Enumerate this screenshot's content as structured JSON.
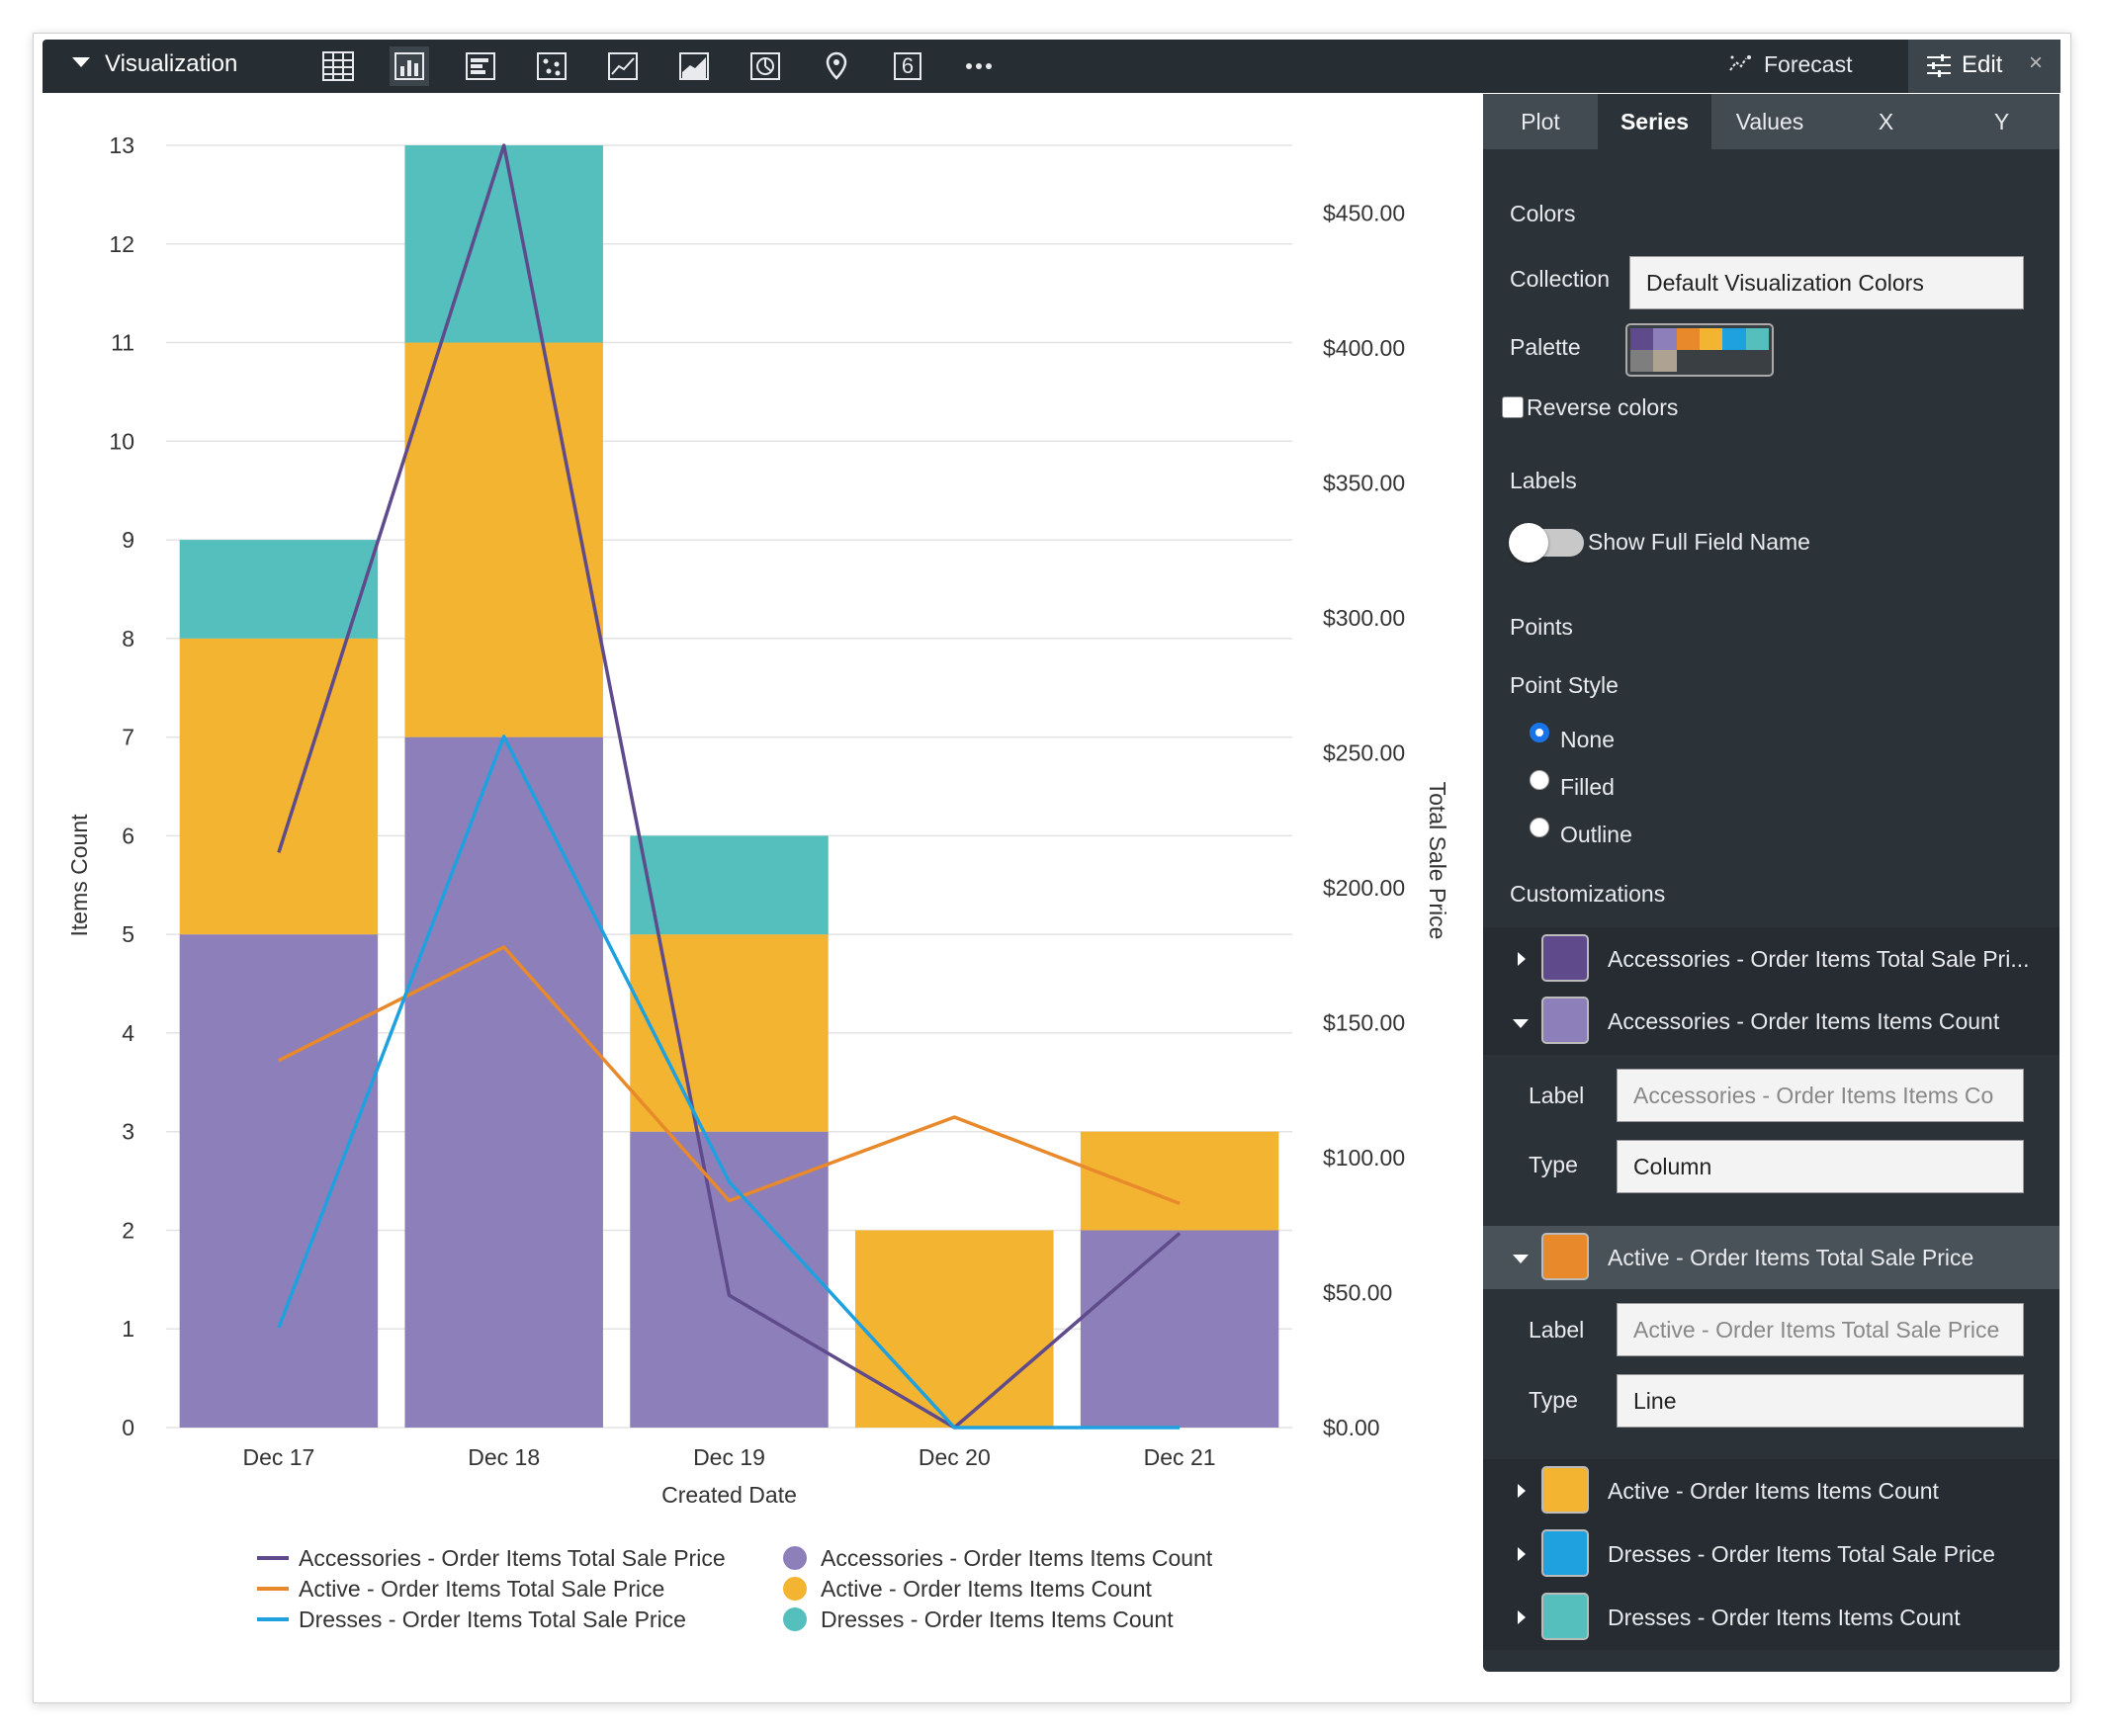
{
  "toolbar": {
    "title": "Visualization",
    "icons": [
      "table-icon",
      "column-chart-icon",
      "bar-chart-icon",
      "scatter-icon",
      "line-chart-icon",
      "area-chart-icon",
      "pie-chart-icon",
      "map-pin-icon",
      "single-value-icon",
      "more-icon"
    ],
    "single_value_glyph": "6",
    "forecast_label": "Forecast",
    "edit_label": "Edit",
    "close_glyph": "×"
  },
  "tabs": [
    "Plot",
    "Series",
    "Values",
    "X",
    "Y"
  ],
  "active_tab": "Series",
  "series_panel": {
    "colors_heading": "Colors",
    "collection_label": "Collection",
    "collection_value": "Default Visualization Colors",
    "palette_label": "Palette",
    "palette_colors": [
      "#5f4b8b",
      "#8c7fba",
      "#e8892b",
      "#f2b431",
      "#1fa1e0",
      "#54bfbd",
      "#7e7e7e",
      "#aea392",
      "#3a3f44",
      "#3a3f44",
      "#3a3f44",
      "#3a3f44"
    ],
    "reverse_colors_label": "Reverse colors",
    "reverse_colors_checked": false,
    "labels_heading": "Labels",
    "show_full_field_name_label": "Show Full Field Name",
    "show_full_field_name_on": false,
    "points_heading": "Points",
    "point_style_label": "Point Style",
    "point_style_options": [
      "None",
      "Filled",
      "Outline"
    ],
    "point_style_selected": "None",
    "customizations_heading": "Customizations",
    "customizations": [
      {
        "name": "Accessories - Order Items Total Sale Pri...",
        "color": "#5f4b8b",
        "expanded": false
      },
      {
        "name": "Accessories - Order Items Items Count",
        "color": "#8c7fba",
        "expanded": true,
        "label_field": "Label",
        "label_placeholder": "Accessories - Order Items Items Co",
        "type_field": "Type",
        "type_value": "Column"
      },
      {
        "name": "Active - Order Items Total Sale Price",
        "color": "#e8892b",
        "expanded": true,
        "label_field": "Label",
        "label_placeholder": "Active - Order Items Total Sale Price",
        "type_field": "Type",
        "type_value": "Line"
      },
      {
        "name": "Active - Order Items Items Count",
        "color": "#f2b431",
        "expanded": false
      },
      {
        "name": "Dresses - Order Items Total Sale Price",
        "color": "#1fa1e0",
        "expanded": false
      },
      {
        "name": "Dresses - Order Items Items Count",
        "color": "#54bfbd",
        "expanded": false
      }
    ]
  },
  "chart_data": {
    "type": "bar",
    "stacked": true,
    "categories": [
      "Dec 17",
      "Dec 18",
      "Dec 19",
      "Dec 20",
      "Dec 21"
    ],
    "xlabel": "Created Date",
    "ylabel": "Items Count",
    "ylabel_right": "Total Sale Price",
    "ylim": [
      0,
      13
    ],
    "yticks": [
      "0",
      "1",
      "2",
      "3",
      "4",
      "5",
      "6",
      "7",
      "8",
      "9",
      "10",
      "11",
      "12",
      "13"
    ],
    "ylim_right": [
      0,
      475
    ],
    "yticks_right": [
      "$0.00",
      "$50.00",
      "$100.00",
      "$150.00",
      "$200.00",
      "$250.00",
      "$300.00",
      "$350.00",
      "$400.00",
      "$450.00"
    ],
    "yticks_right_values": [
      0,
      50,
      100,
      150,
      200,
      250,
      300,
      350,
      400,
      450
    ],
    "grid": true,
    "legend_position": "bottom",
    "bar_series": [
      {
        "name": "Accessories - Order Items Items Count",
        "color": "#8c7fba",
        "values": [
          5,
          7,
          3,
          0,
          2
        ]
      },
      {
        "name": "Active - Order Items Items Count",
        "color": "#f2b431",
        "values": [
          3,
          4,
          2,
          2,
          1
        ]
      },
      {
        "name": "Dresses - Order Items Items Count",
        "color": "#54bfbd",
        "values": [
          1,
          2,
          1,
          0,
          0
        ]
      }
    ],
    "line_series": [
      {
        "name": "Accessories - Order Items Total Sale Price",
        "color": "#5f4b8b",
        "values": [
          213,
          475,
          49,
          0,
          72
        ]
      },
      {
        "name": "Active - Order Items Total Sale Price",
        "color": "#e8892b",
        "values": [
          136,
          178,
          84,
          115,
          83
        ]
      },
      {
        "name": "Dresses - Order Items Total Sale Price",
        "color": "#1fa1e0",
        "values": [
          37,
          256,
          91,
          0,
          0
        ]
      }
    ],
    "legend": [
      {
        "name": "Accessories - Order Items Total Sale Price",
        "color": "#5f4b8b",
        "kind": "line"
      },
      {
        "name": "Accessories - Order Items Items Count",
        "color": "#8c7fba",
        "kind": "dot"
      },
      {
        "name": "Active - Order Items Total Sale Price",
        "color": "#e8892b",
        "kind": "line"
      },
      {
        "name": "Active - Order Items Items Count",
        "color": "#f2b431",
        "kind": "dot"
      },
      {
        "name": "Dresses - Order Items Total Sale Price",
        "color": "#1fa1e0",
        "kind": "line"
      },
      {
        "name": "Dresses - Order Items Items Count",
        "color": "#54bfbd",
        "kind": "dot"
      }
    ]
  }
}
